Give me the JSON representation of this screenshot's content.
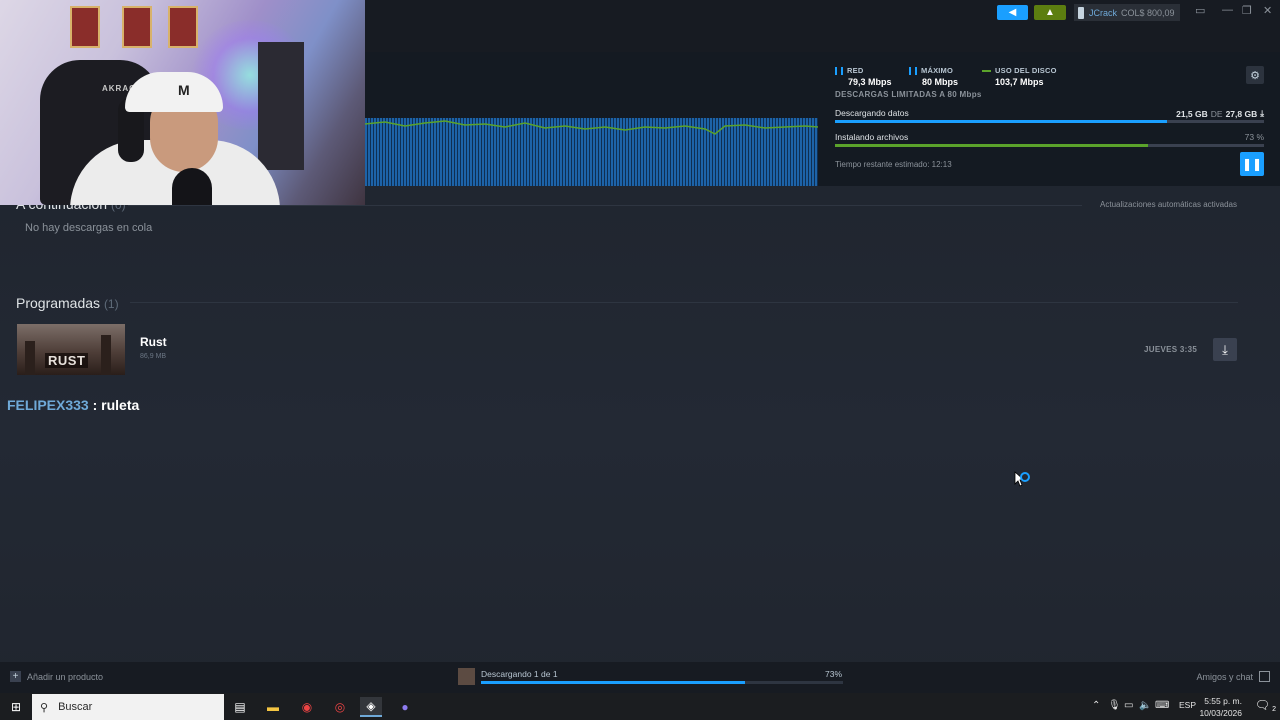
{
  "titlebar": {
    "user": "JCrack",
    "wallet": "COL$ 800,09",
    "icons": [
      "megaphone-icon",
      "bell-icon",
      "monitor-icon",
      "minimize-icon",
      "restore-icon",
      "close-icon"
    ]
  },
  "download_header": {
    "red_label": "RED",
    "red_value": "79,3 Mbps",
    "max_label": "MÁXIMO",
    "max_value": "80 Mbps",
    "disk_label": "USO DEL DISCO",
    "disk_value": "103,7 Mbps",
    "limit_text": "DESCARGAS LIMITADAS A 80 Mbps",
    "downloading_label": "Descargando datos",
    "downloaded": "21,5 GB",
    "de": "DE",
    "total": "27,8 GB",
    "download_progress": 0.773,
    "installing_label": "Instalando archivos",
    "install_pct": "73 %",
    "install_progress": 0.73,
    "eta": "Tiempo restante estimado: 12:13",
    "colors": {
      "accent": "#1a9fff",
      "green": "#5ba32b"
    }
  },
  "queue": {
    "title": "A continuación",
    "count": "(0)",
    "empty": "No hay descargas en cola",
    "auto_updates": "Actualizaciones automáticas activadas"
  },
  "scheduled": {
    "title": "Programadas",
    "count": "(1)",
    "game": {
      "name": "Rust",
      "size": "86,9 MB",
      "logo": "RUST",
      "when": "JUEVES 3:35"
    }
  },
  "chat_overlay": {
    "nick": "FELIPEX333",
    "sep": " : ",
    "msg": "ruleta"
  },
  "bottombar": {
    "add_product": "Añadir un producto",
    "status": "Descargando 1 de 1",
    "pct": "73%",
    "progress": 0.73,
    "friends": "Amigos y chat"
  },
  "taskbar": {
    "search_placeholder": "Buscar",
    "lang": "ESP",
    "time": "5:55 p. m.",
    "date": "10/03/2026",
    "notif_count": "2"
  }
}
